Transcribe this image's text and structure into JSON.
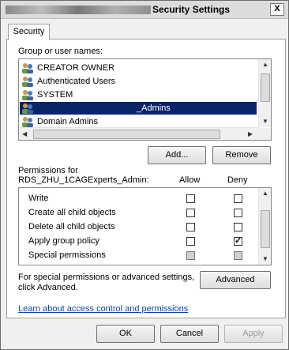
{
  "window": {
    "title": "Security Settings",
    "close_glyph": "X"
  },
  "tabs": [
    {
      "label": "Security"
    }
  ],
  "group_users": {
    "label": "Group or user names:",
    "items": [
      {
        "name": "CREATOR OWNER",
        "icon": "user-group-icon",
        "selected": false
      },
      {
        "name": "Authenticated Users",
        "icon": "user-group-icon",
        "selected": false
      },
      {
        "name": "SYSTEM",
        "icon": "user-group-icon",
        "selected": false
      },
      {
        "name": "_Admins",
        "icon": "user-group-icon",
        "selected": true
      },
      {
        "name": "Domain Admins",
        "icon": "user-group-icon",
        "selected": false
      }
    ],
    "add_label": "Add...",
    "remove_label": "Remove"
  },
  "permissions": {
    "label_line1": "Permissions for",
    "label_line2": "RDS_ZHU_1CAGExperts_Admin:",
    "allow_label": "Allow",
    "deny_label": "Deny",
    "rows": [
      {
        "name": "Write",
        "allow": false,
        "deny": false,
        "disabled": false
      },
      {
        "name": "Create all child objects",
        "allow": false,
        "deny": false,
        "disabled": false
      },
      {
        "name": "Delete all child objects",
        "allow": false,
        "deny": false,
        "disabled": false
      },
      {
        "name": "Apply group policy",
        "allow": false,
        "deny": true,
        "disabled": false
      },
      {
        "name": "Special permissions",
        "allow": false,
        "deny": false,
        "disabled": true
      }
    ]
  },
  "advanced": {
    "text_line1": "For special permissions or advanced settings,",
    "text_line2": "click Advanced.",
    "button_label": "Advanced"
  },
  "help_link": "Learn about access control and permissions",
  "footer": {
    "ok_label": "OK",
    "cancel_label": "Cancel",
    "apply_label": "Apply"
  },
  "colors": {
    "selection": "#0a246a",
    "link": "#0645ad"
  }
}
